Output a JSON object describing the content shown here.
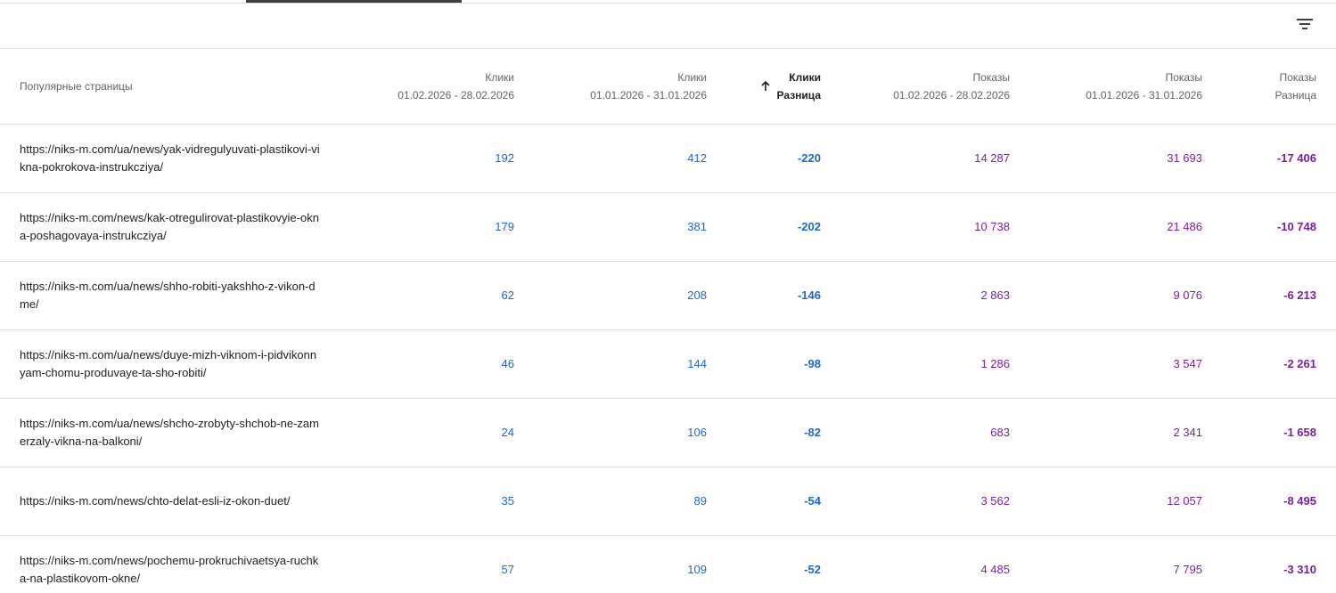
{
  "toolbar": {
    "filter_icon": "filter-list-icon"
  },
  "table": {
    "headers": {
      "page": "Популярные страницы",
      "clicks_current": {
        "metric": "Клики",
        "period": "01.02.2026 - 28.02.2026"
      },
      "clicks_previous": {
        "metric": "Клики",
        "period": "01.01.2026 - 31.01.2026"
      },
      "clicks_diff": {
        "metric": "Клики",
        "period": "Разница"
      },
      "imps_current": {
        "metric": "Показы",
        "period": "01.02.2026 - 28.02.2026"
      },
      "imps_previous": {
        "metric": "Показы",
        "period": "01.01.2026 - 31.01.2026"
      },
      "imps_diff": {
        "metric": "Показы",
        "period": "Разница"
      }
    },
    "sort_icon": "arrow-upward-icon",
    "rows": [
      {
        "url": "https://niks-m.com/ua/news/yak-vidregulyuvati-plastikovi-vikna-pokrokova-instrukcziya/",
        "clicks_current": "192",
        "clicks_previous": "412",
        "clicks_diff": "-220",
        "imps_current": "14 287",
        "imps_previous": "31 693",
        "imps_diff": "-17 406"
      },
      {
        "url": "https://niks-m.com/news/kak-otregulirovat-plastikovyie-okna-poshagovaya-instrukcziya/",
        "clicks_current": "179",
        "clicks_previous": "381",
        "clicks_diff": "-202",
        "imps_current": "10 738",
        "imps_previous": "21 486",
        "imps_diff": "-10 748"
      },
      {
        "url": "https://niks-m.com/ua/news/shho-robiti-yakshho-z-vikon-dme/",
        "clicks_current": "62",
        "clicks_previous": "208",
        "clicks_diff": "-146",
        "imps_current": "2 863",
        "imps_previous": "9 076",
        "imps_diff": "-6 213"
      },
      {
        "url": "https://niks-m.com/ua/news/duye-mizh-viknom-i-pidvikonnyam-chomu-produvaye-ta-sho-robiti/",
        "clicks_current": "46",
        "clicks_previous": "144",
        "clicks_diff": "-98",
        "imps_current": "1 286",
        "imps_previous": "3 547",
        "imps_diff": "-2 261"
      },
      {
        "url": "https://niks-m.com/ua/news/shcho-zrobyty-shchob-ne-zamerzaly-vikna-na-balkoni/",
        "clicks_current": "24",
        "clicks_previous": "106",
        "clicks_diff": "-82",
        "imps_current": "683",
        "imps_previous": "2 341",
        "imps_diff": "-1 658"
      },
      {
        "url": "https://niks-m.com/news/chto-delat-esli-iz-okon-duet/",
        "clicks_current": "35",
        "clicks_previous": "89",
        "clicks_diff": "-54",
        "imps_current": "3 562",
        "imps_previous": "12 057",
        "imps_diff": "-8 495"
      },
      {
        "url": "https://niks-m.com/news/pochemu-prokruchivaetsya-ruchka-na-plastikovom-okne/",
        "clicks_current": "57",
        "clicks_previous": "109",
        "clicks_diff": "-52",
        "imps_current": "4 485",
        "imps_previous": "7 795",
        "imps_diff": "-3 310"
      }
    ]
  },
  "colors": {
    "clicks": "#1967d2",
    "impressions": "#7b1fa2",
    "divider": "#e0e0e0"
  }
}
